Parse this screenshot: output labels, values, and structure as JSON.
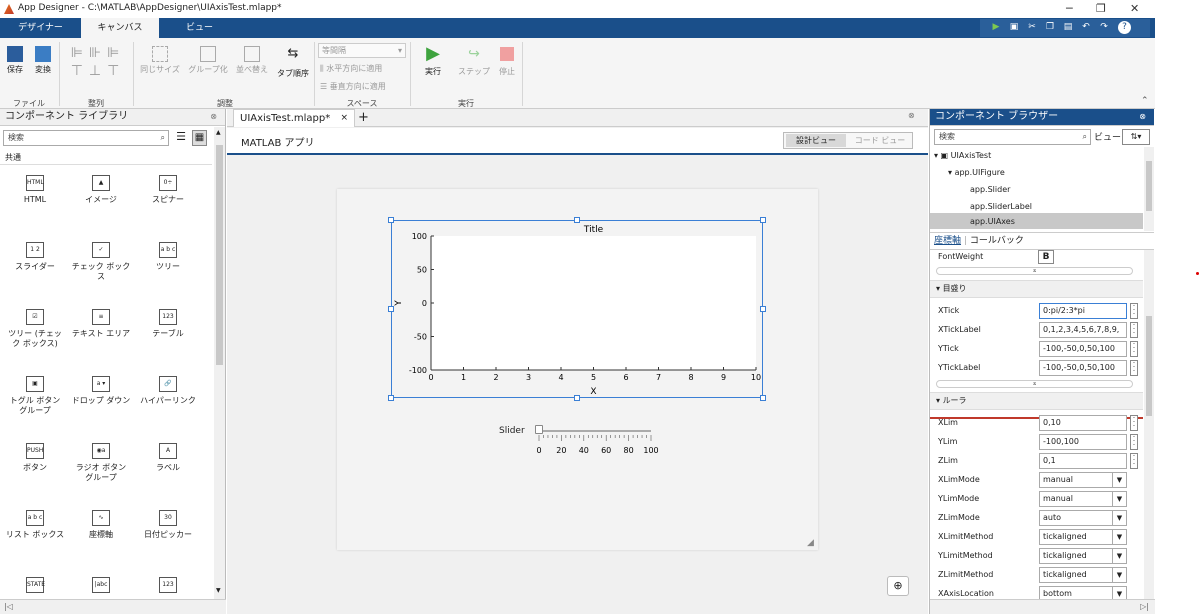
{
  "window": {
    "title": "App Designer - C:\\MATLAB\\AppDesigner\\UIAxisTest.mlapp*",
    "min": "─",
    "max": "❐",
    "close": "✕"
  },
  "maintabs": [
    "デザイナー",
    "キャンバス",
    "ビュー"
  ],
  "ribbon": {
    "save": "保存",
    "convert": "変換",
    "file_section": "ファイル",
    "align_section": "整列",
    "same_size": "同じサイズ",
    "group": "グループ化",
    "arrange": "並べ替え",
    "tab_order": "タブ順序",
    "arrange_section": "調整",
    "equal_spacing": "等間隔",
    "apply_h": "水平方向に適用",
    "apply_v": "垂直方向に適用",
    "space_section": "スペース",
    "run": "実行",
    "step": "ステップ",
    "stop": "停止",
    "run_section": "実行"
  },
  "library": {
    "title": "コンポーネント ライブラリ",
    "search": "検索",
    "category": "共通",
    "items": [
      {
        "label": "HTML",
        "icon": "HTML"
      },
      {
        "label": "イメージ",
        "icon": "▲"
      },
      {
        "label": "スピナー",
        "icon": "0÷"
      },
      {
        "label": "スライダー",
        "icon": "1 2"
      },
      {
        "label": "チェック ボックス",
        "icon": "✓"
      },
      {
        "label": "ツリー",
        "icon": "a b c"
      },
      {
        "label": "ツリー (チェック ボックス)",
        "icon": "☑"
      },
      {
        "label": "テキスト エリア",
        "icon": "≡"
      },
      {
        "label": "テーブル",
        "icon": "123"
      },
      {
        "label": "トグル ボタン グループ",
        "icon": "▣"
      },
      {
        "label": "ドロップ ダウン",
        "icon": "a ▾"
      },
      {
        "label": "ハイパーリンク",
        "icon": "🔗"
      },
      {
        "label": "ボタン",
        "icon": "PUSH"
      },
      {
        "label": "ラジオ ボタン グループ",
        "icon": "◉a"
      },
      {
        "label": "ラベル",
        "icon": "A"
      },
      {
        "label": "リスト ボックス",
        "icon": "a b c"
      },
      {
        "label": "座標軸",
        "icon": "∿"
      },
      {
        "label": "日付ピッカー",
        "icon": "30"
      },
      {
        "label": "",
        "icon": "STATE"
      },
      {
        "label": "",
        "icon": "|abc"
      },
      {
        "label": "",
        "icon": "123"
      }
    ]
  },
  "doc": {
    "tab": "UIAxisTest.mlapp*",
    "add": "+",
    "app_label": "MATLAB アプリ",
    "design_view": "設計ビュー",
    "code_view": "コード ビュー"
  },
  "axes": {
    "title": "Title",
    "xlabel": "X",
    "ylabel": "Y",
    "xticks": [
      "0",
      "1",
      "2",
      "3",
      "4",
      "5",
      "6",
      "7",
      "8",
      "9",
      "10"
    ],
    "yticks": [
      "100",
      "50",
      "0",
      "-50",
      "-100"
    ]
  },
  "slider": {
    "label": "Slider",
    "ticks": [
      "0",
      "20",
      "40",
      "60",
      "80",
      "100"
    ],
    "value": 0
  },
  "browser": {
    "title": "コンポーネント ブラウザー",
    "search": "検索",
    "view_label": "ビュー",
    "tree": [
      "UIAxisTest",
      "app.UIFigure",
      "app.Slider",
      "app.SliderLabel",
      "app.UIAxes"
    ],
    "tabs": [
      "座標軸",
      "コールバック"
    ],
    "fontweight_label": "FontWeight",
    "fontweight_value": "B",
    "ticks_section": "目盛り",
    "tick_props": [
      {
        "name": "XTick",
        "value": "0:pi/2:3*pi"
      },
      {
        "name": "XTickLabel",
        "value": "0,1,2,3,4,5,6,7,8,9,"
      },
      {
        "name": "YTick",
        "value": "-100,-50,0,50,100"
      },
      {
        "name": "YTickLabel",
        "value": "-100,-50,0,50,100"
      }
    ],
    "ruler_section": "ルーラ",
    "ruler_vals": [
      {
        "name": "XLim",
        "value": "0,10"
      },
      {
        "name": "YLim",
        "value": "-100,100"
      },
      {
        "name": "ZLim",
        "value": "0,1"
      }
    ],
    "ruler_dds": [
      {
        "name": "XLimMode",
        "value": "manual"
      },
      {
        "name": "YLimMode",
        "value": "manual"
      },
      {
        "name": "ZLimMode",
        "value": "auto"
      },
      {
        "name": "XLimitMethod",
        "value": "tickaligned"
      },
      {
        "name": "YLimitMethod",
        "value": "tickaligned"
      },
      {
        "name": "ZLimitMethod",
        "value": "tickaligned"
      },
      {
        "name": "XAxisLocation",
        "value": "bottom"
      }
    ]
  },
  "colors": {
    "titlebar_bg": "#1a4f8a",
    "accent": "#3a7fd5",
    "highlight_line": "#c0392b"
  }
}
